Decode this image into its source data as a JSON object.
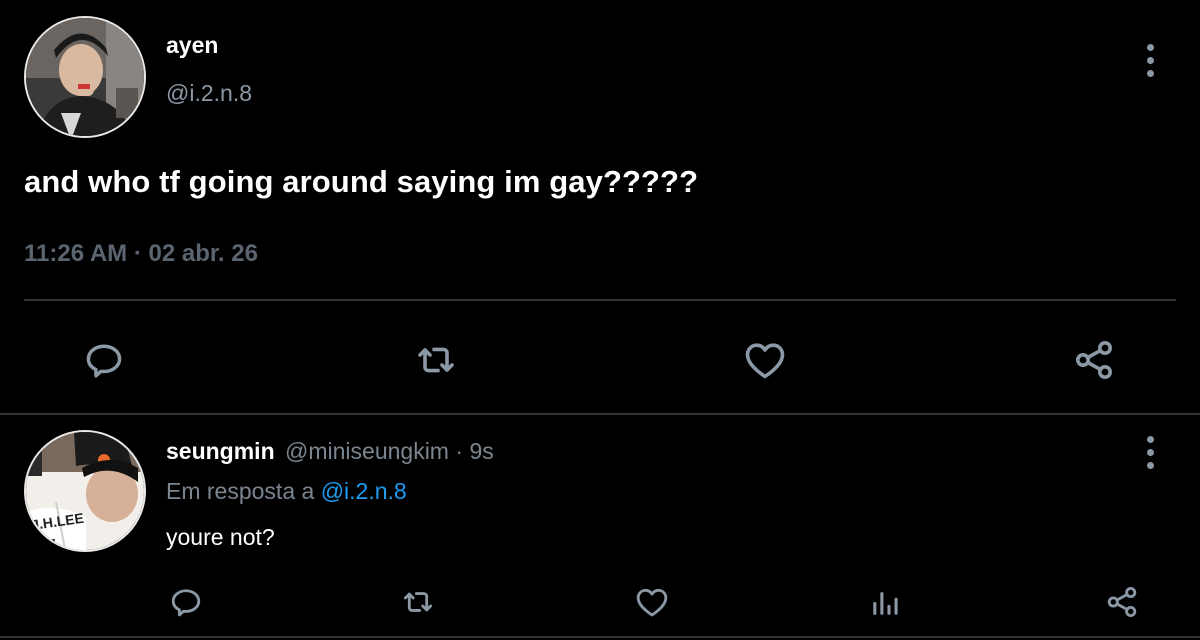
{
  "colors": {
    "background": "#000000",
    "text": "#ffffff",
    "muted": "#6e767d",
    "link": "#1d9bf0",
    "icon": "#8b98a5",
    "divider": "#2f3336"
  },
  "main_tweet": {
    "display_name": "ayen",
    "handle": "@i.2.n.8",
    "text": "and who tf going around saying im gay?????",
    "time": "11:26 AM",
    "separator": "·",
    "date": "02 abr. 26",
    "avatar_icon": "profile-photo",
    "actions": [
      "reply-icon",
      "retweet-icon",
      "like-icon",
      "share-icon"
    ]
  },
  "reply_tweet": {
    "display_name": "seungmin",
    "handle": "@miniseungkim",
    "separator": "·",
    "age": "9s",
    "reply_prefix": "Em resposta a",
    "reply_to": "@i.2.n.8",
    "text": "youre not?",
    "avatar_jersey_text": "J.H.LEE",
    "actions": [
      "reply-icon",
      "retweet-icon",
      "like-icon",
      "analytics-icon",
      "share-icon"
    ]
  }
}
